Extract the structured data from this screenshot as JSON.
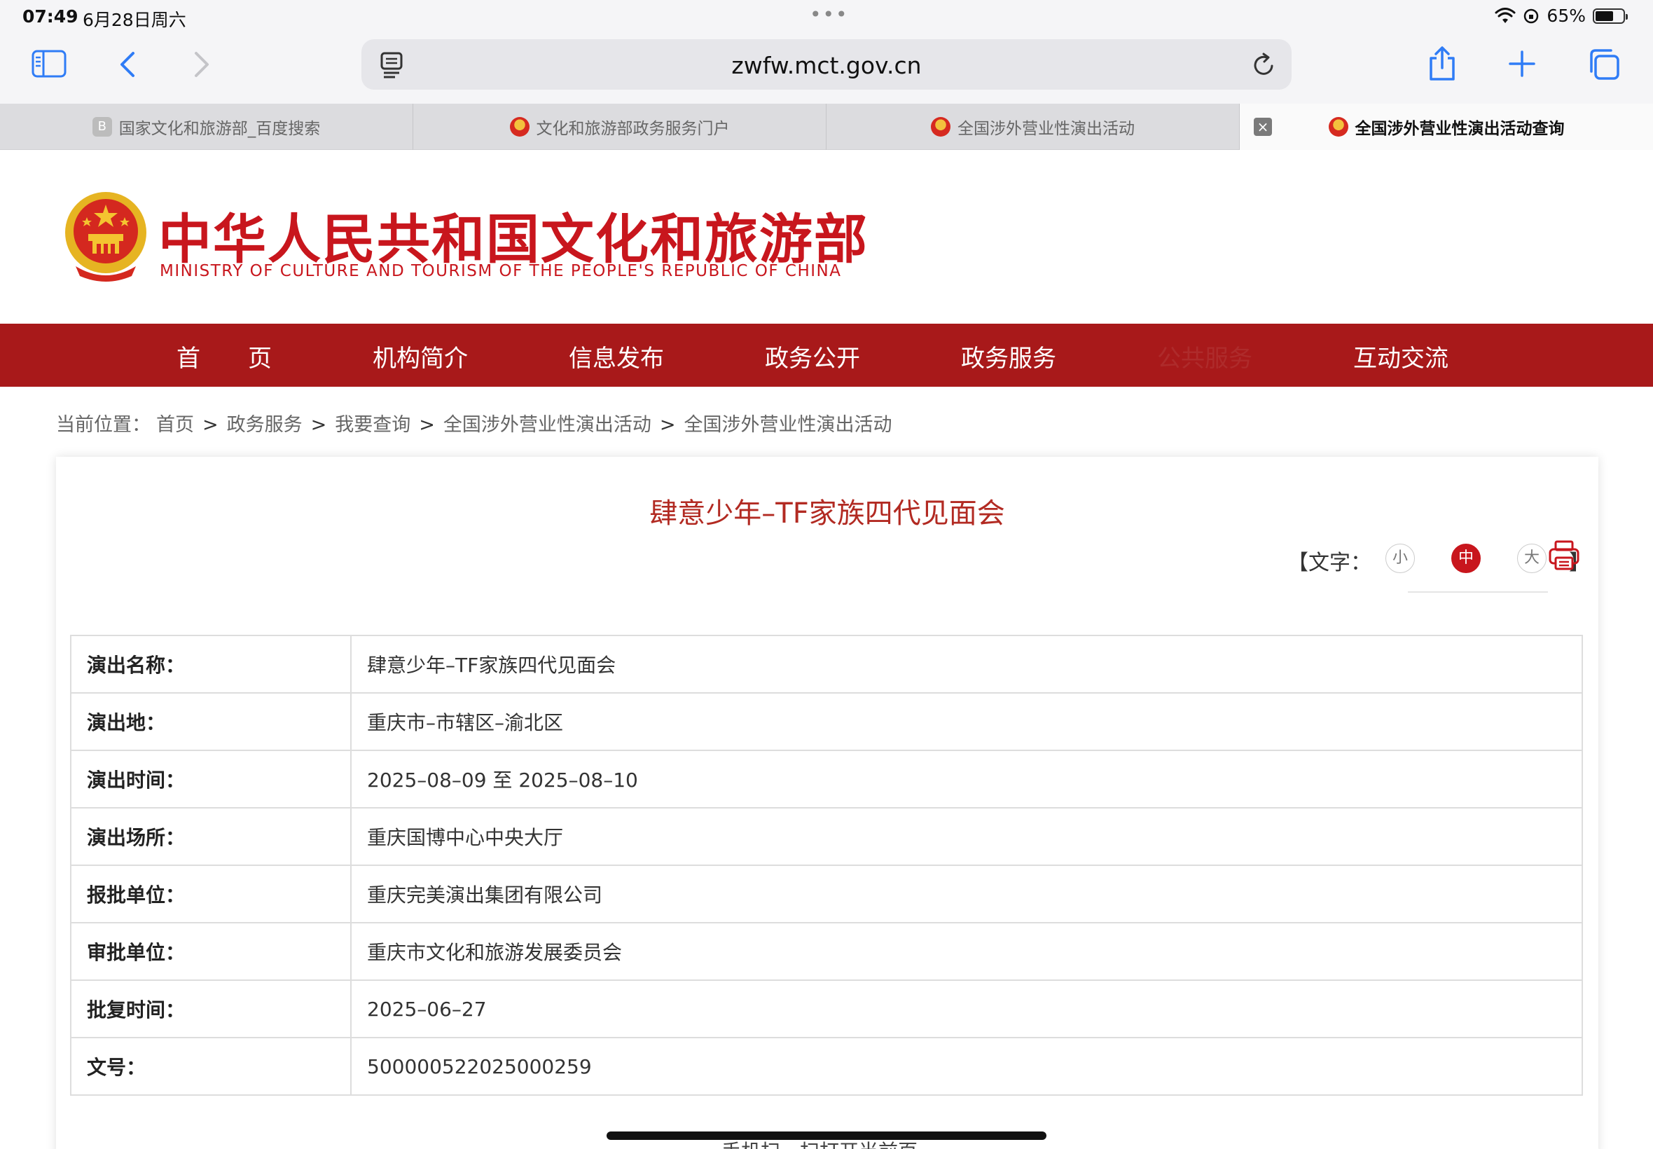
{
  "status_bar": {
    "time": "07:49",
    "date": "6月28日周六",
    "battery_percent": "65%",
    "battery_level": 0.65
  },
  "toolbar": {
    "url": "zwfw.mct.gov.cn"
  },
  "tabs": [
    {
      "label": "国家文化和旅游部_百度搜索",
      "icon": "baidu-icon",
      "favicon_text": "B"
    },
    {
      "label": "文化和旅游部政务服务门户",
      "icon": "emblem-icon"
    },
    {
      "label": "全国涉外营业性演出活动",
      "icon": "emblem-icon"
    },
    {
      "label": "全国涉外营业性演出活动查询",
      "icon": "emblem-icon",
      "active": true
    }
  ],
  "header": {
    "title_cn": "中华人民共和国文化和旅游部",
    "title_en": "MINISTRY OF CULTURE AND TOURISM OF THE PEOPLE'S REPUBLIC OF CHINA"
  },
  "nav": {
    "items": [
      "首　　页",
      "机构简介",
      "信息发布",
      "政务公开",
      "政务服务",
      "互动交流"
    ],
    "hidden_item": "公共服务"
  },
  "breadcrumb": {
    "prefix": "当前位置：",
    "items": [
      "首页",
      "政务服务",
      "我要查询",
      "全国涉外营业性演出活动",
      "全国涉外营业性演出活动"
    ],
    "separator": ">"
  },
  "article": {
    "title": "肆意少年–TF家族四代见面会",
    "font_size_label": "【文字：",
    "font_size_small": "小",
    "font_size_medium": "中",
    "font_size_large": "大",
    "font_size_close": "】"
  },
  "table": {
    "rows": [
      {
        "label": "演出名称：",
        "value": "肆意少年–TF家族四代见面会"
      },
      {
        "label": "演出地：",
        "value": "重庆市–市辖区–渝北区"
      },
      {
        "label": "演出时间：",
        "value": "2025–08–09 至 2025–08–10"
      },
      {
        "label": "演出场所：",
        "value": "重庆国博中心中央大厅"
      },
      {
        "label": "报批单位：",
        "value": "重庆完美演出集团有限公司"
      },
      {
        "label": "审批单位：",
        "value": "重庆市文化和旅游发展委员会"
      },
      {
        "label": "批复时间：",
        "value": "2025–06–27"
      },
      {
        "label": "文号：",
        "value": "500000522025000259"
      }
    ]
  },
  "footer_peek": "手机扫一扫打开当前页",
  "colors": {
    "brand_red": "#a8191a",
    "title_red": "#c8161d",
    "accent_blue": "#2f7cf6"
  }
}
